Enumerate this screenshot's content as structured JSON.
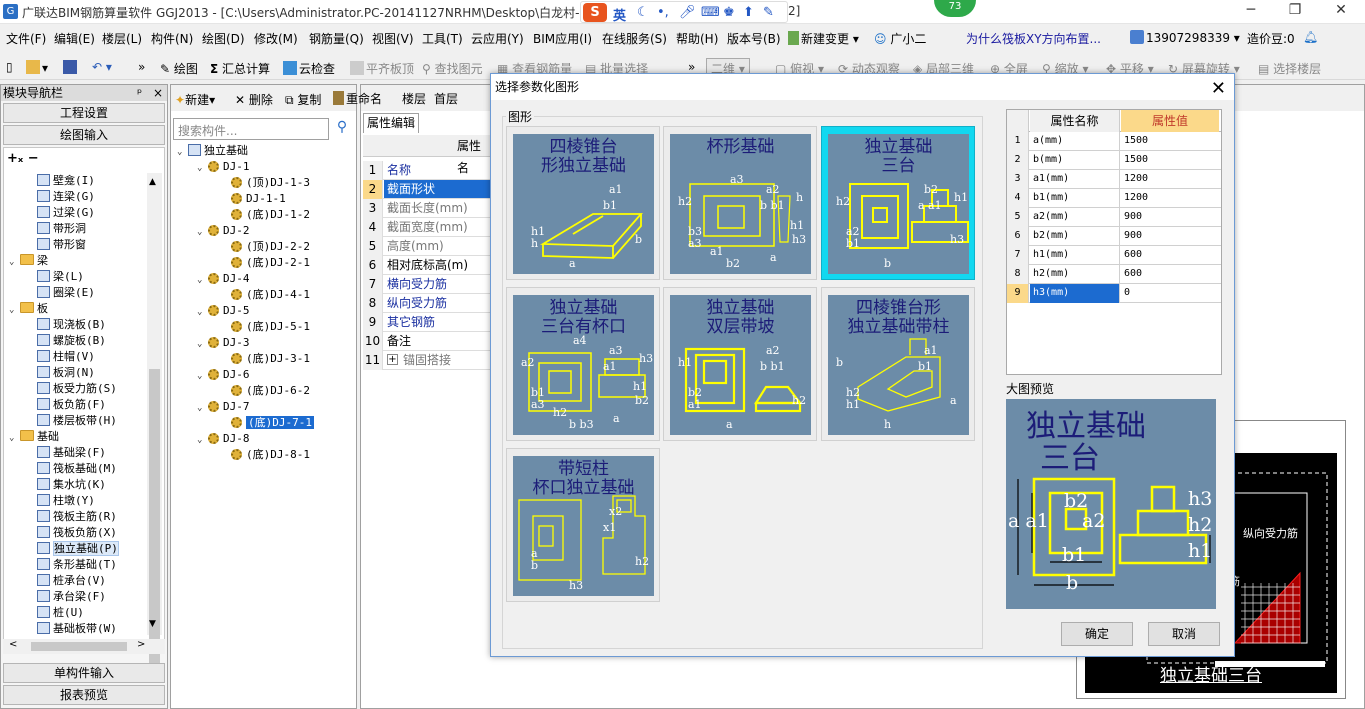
{
  "titlebar": {
    "text": "广联达BIM钢筋算量软件 GGJ2013 - [C:\\Users\\Administrator.PC-20141127NRHM\\Desktop\\白龙村-",
    "text_tail": "2]",
    "badge": "73",
    "ime_lang": "英",
    "minimize": "─",
    "restore": "❐",
    "close": "✕"
  },
  "menubar": {
    "items": [
      "文件(F)",
      "编辑(E)",
      "楼层(L)",
      "构件(N)",
      "绘图(D)",
      "修改(M)",
      "钢筋量(Q)",
      "视图(V)",
      "工具(T)",
      "云应用(Y)",
      "BIM应用(I)",
      "在线服务(S)",
      "帮助(H)",
      "版本号(B)"
    ],
    "new_change": "新建变更 ▾",
    "helper": "广小二",
    "question": "为什么筏板XY方向布置...",
    "phone": "13907298339",
    "price": "造价豆:0"
  },
  "toolbar": {
    "items": [
      "绘图",
      "汇总计算",
      "云检查",
      "平齐板顶",
      "查找图元",
      "查看钢筋量",
      "批量选择"
    ],
    "view_mode": "二维",
    "right_items": [
      "俯视",
      "动态观察",
      "局部三维",
      "全屏",
      "缩放",
      "平移",
      "屏幕旋转",
      "选择楼层"
    ]
  },
  "left_panel": {
    "title": "模块导航栏",
    "pin": "ᵖ",
    "close": "×",
    "tab_project": "工程设置",
    "tab_draw": "绘图输入",
    "tree": [
      {
        "label": "壁龛(I)",
        "type": "item"
      },
      {
        "label": "连梁(G)",
        "type": "item"
      },
      {
        "label": "过梁(G)",
        "type": "item"
      },
      {
        "label": "带形洞",
        "type": "item"
      },
      {
        "label": "带形窗",
        "type": "item"
      },
      {
        "label": "梁",
        "type": "folder"
      },
      {
        "label": "梁(L)",
        "type": "item"
      },
      {
        "label": "圈梁(E)",
        "type": "item"
      },
      {
        "label": "板",
        "type": "folder"
      },
      {
        "label": "现浇板(B)",
        "type": "item"
      },
      {
        "label": "螺旋板(B)",
        "type": "item"
      },
      {
        "label": "柱帽(V)",
        "type": "item"
      },
      {
        "label": "板洞(N)",
        "type": "item"
      },
      {
        "label": "板受力筋(S)",
        "type": "item"
      },
      {
        "label": "板负筋(F)",
        "type": "item"
      },
      {
        "label": "楼层板带(H)",
        "type": "item"
      },
      {
        "label": "基础",
        "type": "folder"
      },
      {
        "label": "基础梁(F)",
        "type": "item"
      },
      {
        "label": "筏板基础(M)",
        "type": "item"
      },
      {
        "label": "集水坑(K)",
        "type": "item"
      },
      {
        "label": "柱墩(Y)",
        "type": "item"
      },
      {
        "label": "筏板主筋(R)",
        "type": "item"
      },
      {
        "label": "筏板负筋(X)",
        "type": "item"
      },
      {
        "label": "独立基础(P)",
        "type": "item"
      },
      {
        "label": "条形基础(T)",
        "type": "item"
      },
      {
        "label": "桩承台(V)",
        "type": "item"
      },
      {
        "label": "承台梁(F)",
        "type": "item"
      },
      {
        "label": "桩(U)",
        "type": "item"
      },
      {
        "label": "基础板带(W)",
        "type": "item"
      }
    ],
    "btn_single": "单构件输入",
    "btn_report": "报表预览"
  },
  "mid_panel": {
    "toolbar_new": "新建",
    "toolbar_delete": "删除",
    "toolbar_copy": "复制",
    "toolbar_rename": "重命名",
    "toolbar_floor": "楼层",
    "toolbar_floor_value": "首层",
    "search_placeholder": "搜索构件...",
    "tree": [
      {
        "label": "独立基础",
        "level": 0
      },
      {
        "label": "DJ-1",
        "level": 1
      },
      {
        "label": "(顶)DJ-1-3",
        "level": 2
      },
      {
        "label": "DJ-1-1",
        "level": 2
      },
      {
        "label": "(底)DJ-1-2",
        "level": 2
      },
      {
        "label": "DJ-2",
        "level": 1
      },
      {
        "label": "(顶)DJ-2-2",
        "level": 2
      },
      {
        "label": "(底)DJ-2-1",
        "level": 2
      },
      {
        "label": "DJ-4",
        "level": 1
      },
      {
        "label": "(底)DJ-4-1",
        "level": 2
      },
      {
        "label": "DJ-5",
        "level": 1
      },
      {
        "label": "(底)DJ-5-1",
        "level": 2
      },
      {
        "label": "DJ-3",
        "level": 1
      },
      {
        "label": "(底)DJ-3-1",
        "level": 2
      },
      {
        "label": "DJ-6",
        "level": 1
      },
      {
        "label": "(底)DJ-6-2",
        "level": 2
      },
      {
        "label": "DJ-7",
        "level": 1
      },
      {
        "label": "(底)DJ-7-1",
        "level": 2,
        "selected": true
      },
      {
        "label": "DJ-8",
        "level": 1
      },
      {
        "label": "(底)DJ-8-1",
        "level": 2
      }
    ]
  },
  "prop_panel": {
    "tab": "属性编辑",
    "header": "属性名",
    "rows": [
      {
        "n": "1",
        "label": "名称",
        "style": "link"
      },
      {
        "n": "2",
        "label": "截面形状",
        "style": "sel"
      },
      {
        "n": "3",
        "label": "截面长度(mm)",
        "style": "gray"
      },
      {
        "n": "4",
        "label": "截面宽度(mm)",
        "style": "gray"
      },
      {
        "n": "5",
        "label": "高度(mm)",
        "style": "gray"
      },
      {
        "n": "6",
        "label": "相对底标高(m)",
        "style": "normal"
      },
      {
        "n": "7",
        "label": "横向受力筋",
        "style": "link"
      },
      {
        "n": "8",
        "label": "纵向受力筋",
        "style": "link"
      },
      {
        "n": "9",
        "label": "其它钢筋",
        "style": "link"
      },
      {
        "n": "10",
        "label": "备注",
        "style": "normal"
      },
      {
        "n": "11",
        "label": "锚固搭接",
        "style": "gray",
        "expand": "+"
      }
    ]
  },
  "dialog": {
    "title": "选择参数化图形",
    "close": "✕",
    "group_label": "图形",
    "shapes": [
      {
        "caption_lines": [
          "四棱锥台",
          "形独立基础"
        ],
        "labels": [
          "a1",
          "b1",
          "h1",
          "h",
          "a",
          "b"
        ],
        "selected": false
      },
      {
        "caption_lines": [
          "杯形基础"
        ],
        "labels": [
          "a2",
          "b b1",
          "b3",
          "a3",
          "b2",
          "h3",
          "h2",
          "h",
          "a1",
          "h1",
          "a3",
          "a"
        ],
        "selected": false
      },
      {
        "caption_lines": [
          "独立基础",
          "三台"
        ],
        "labels": [
          "b2",
          "a a1",
          "a2",
          "b1",
          "b",
          "h3",
          "h2",
          "h1"
        ],
        "selected": true
      },
      {
        "caption_lines": [
          "独立基础",
          "三台有杯口"
        ],
        "labels": [
          "a3",
          "a1",
          "b1",
          "a3",
          "b b3",
          "b2",
          "a2",
          "h3",
          "h2",
          "h1",
          "a4",
          "a"
        ],
        "selected": false
      },
      {
        "caption_lines": [
          "独立基础",
          "双层带坡"
        ],
        "labels": [
          "a2",
          "b b1",
          "b2",
          "a1",
          "a",
          "h2",
          "h1"
        ],
        "selected": false
      },
      {
        "caption_lines": [
          "四棱锥台形",
          "独立基础带柱"
        ],
        "labels": [
          "a1",
          "b1",
          "h2",
          "h1",
          "h",
          "a",
          "b"
        ],
        "selected": false
      },
      {
        "caption_lines": [
          "带短柱",
          "杯口独立基础"
        ],
        "labels": [
          "x2",
          "x1",
          "a",
          "b",
          "h3",
          "h2"
        ],
        "selected": false
      }
    ],
    "attr_header_name": "属性名称",
    "attr_header_value": "属性值",
    "attrs": [
      {
        "i": "1",
        "name": "a(mm)",
        "value": "1500"
      },
      {
        "i": "2",
        "name": "b(mm)",
        "value": "1500"
      },
      {
        "i": "3",
        "name": "a1(mm)",
        "value": "1200"
      },
      {
        "i": "4",
        "name": "b1(mm)",
        "value": "1200"
      },
      {
        "i": "5",
        "name": "a2(mm)",
        "value": "900"
      },
      {
        "i": "6",
        "name": "b2(mm)",
        "value": "900"
      },
      {
        "i": "7",
        "name": "h1(mm)",
        "value": "600"
      },
      {
        "i": "8",
        "name": "h2(mm)",
        "value": "600"
      },
      {
        "i": "9",
        "name": "h3(mm)",
        "value": "0"
      }
    ],
    "preview_label": "大图预览",
    "preview_caption_lines": [
      "独立基础",
      "三台"
    ],
    "preview_labels": [
      "b2",
      "a a1",
      "a2",
      "b1",
      "b",
      "h3",
      "h2",
      "h1"
    ],
    "ok": "确定",
    "cancel": "取消"
  },
  "canvas": {
    "label1": "纵向受力筋",
    "label2": "筋",
    "caption": "独立基础三台"
  }
}
